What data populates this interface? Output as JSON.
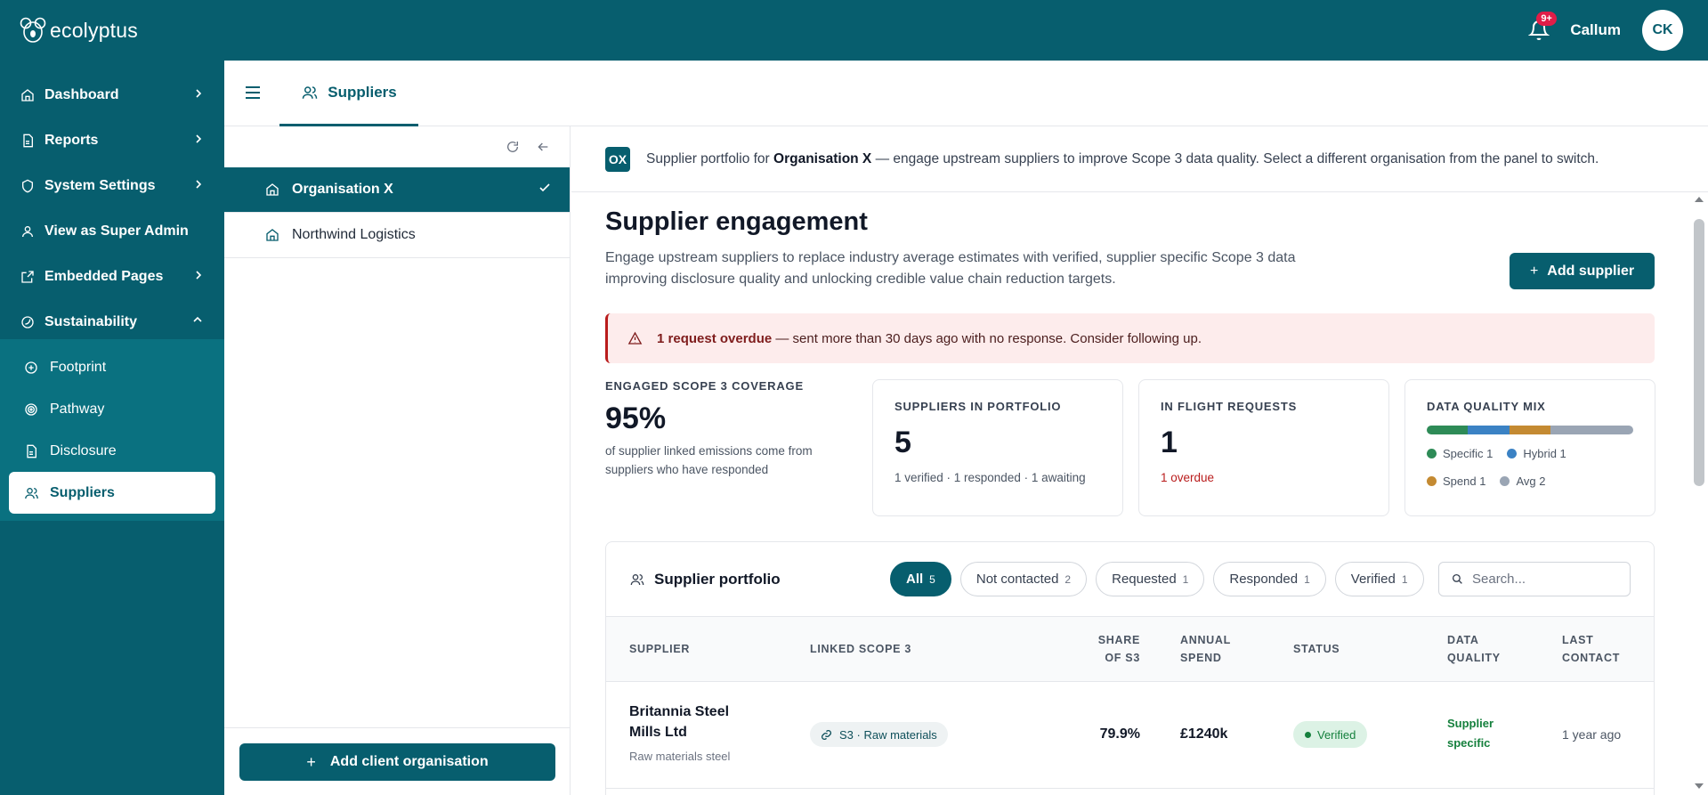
{
  "app": {
    "brand": "ecolyptus"
  },
  "header": {
    "notification_badge": "9+",
    "user_name": "Callum",
    "avatar_initials": "CK"
  },
  "sidebar": {
    "items": [
      {
        "label": "Dashboard",
        "icon": "home-icon",
        "chevron": "right"
      },
      {
        "label": "Reports",
        "icon": "document-icon",
        "chevron": "right"
      },
      {
        "label": "System Settings",
        "icon": "shield-icon",
        "chevron": "right"
      },
      {
        "label": "View as Super Admin",
        "icon": "user-icon",
        "chevron": "none"
      },
      {
        "label": "Embedded Pages",
        "icon": "external-link-icon",
        "chevron": "right"
      },
      {
        "label": "Sustainability",
        "icon": "leaf-icon",
        "chevron": "up"
      }
    ],
    "sub_items": [
      {
        "label": "Footprint",
        "icon": "plus-circle-icon",
        "active": false
      },
      {
        "label": "Pathway",
        "icon": "target-icon",
        "active": false
      },
      {
        "label": "Disclosure",
        "icon": "document-icon",
        "active": false
      },
      {
        "label": "Suppliers",
        "icon": "users-icon",
        "active": true
      }
    ]
  },
  "tabbar": {
    "tab_label": "Suppliers"
  },
  "org_panel": {
    "orgs": [
      {
        "name": "Organisation X",
        "active": true
      },
      {
        "name": "Northwind Logistics",
        "active": false
      }
    ],
    "add_button": "Add client organisation"
  },
  "infobar": {
    "logo": "OX",
    "text_before": "Supplier portfolio for ",
    "org": "Organisation X",
    "text_after": " — engage upstream suppliers to improve Scope 3 data quality. Select a different organisation from the panel to switch."
  },
  "page": {
    "title": "Supplier engagement",
    "description": "Engage upstream suppliers to replace industry average estimates with verified, supplier specific Scope 3 data improving disclosure quality and unlocking credible value chain reduction targets.",
    "add_button": "Add supplier"
  },
  "alert": {
    "bold": "1 request overdue",
    "text": " — sent more than 30 days ago with no response. Consider following up."
  },
  "stats": {
    "coverage": {
      "label": "ENGAGED SCOPE 3 COVERAGE",
      "value": "95%",
      "caption": "of supplier linked emissions come from suppliers who have responded"
    },
    "portfolio": {
      "label": "SUPPLIERS IN PORTFOLIO",
      "value": "5",
      "caption": "1 verified · 1 responded · 1 awaiting"
    },
    "inflight": {
      "label": "IN FLIGHT REQUESTS",
      "value": "1",
      "caption": "1 overdue"
    },
    "dq": {
      "label": "DATA QUALITY MIX",
      "segments": [
        {
          "label": "Specific 1",
          "value": 1,
          "color": "#2e8b57"
        },
        {
          "label": "Hybrid 1",
          "value": 1,
          "color": "#3b82c4"
        },
        {
          "label": "Spend 1",
          "value": 1,
          "color": "#c48a32"
        },
        {
          "label": "Avg 2",
          "value": 2,
          "color": "#9aa5b4"
        }
      ]
    }
  },
  "portfolio": {
    "title": "Supplier portfolio",
    "filters": [
      {
        "label": "All",
        "count": "5",
        "active": true
      },
      {
        "label": "Not contacted",
        "count": "2",
        "active": false
      },
      {
        "label": "Requested",
        "count": "1",
        "active": false
      },
      {
        "label": "Responded",
        "count": "1",
        "active": false
      },
      {
        "label": "Verified",
        "count": "1",
        "active": false
      }
    ],
    "search_placeholder": "Search...",
    "columns": {
      "supplier": "SUPPLIER",
      "linked": "LINKED SCOPE 3",
      "share_1": "SHARE",
      "share_2": "OF S3",
      "spend_1": "ANNUAL",
      "spend_2": "SPEND",
      "status": "STATUS",
      "dq_1": "DATA",
      "dq_2": "QUALITY",
      "last_1": "LAST",
      "last_2": "CONTACT"
    },
    "rows": [
      {
        "supplier": "Britannia Steel Mills Ltd",
        "category": "Raw materials steel",
        "linked": "S3 · Raw materials",
        "share": "79.9%",
        "spend": "£1240k",
        "status": "Verified",
        "dq": "Supplier specific",
        "last_contact": "1 year ago"
      }
    ]
  }
}
